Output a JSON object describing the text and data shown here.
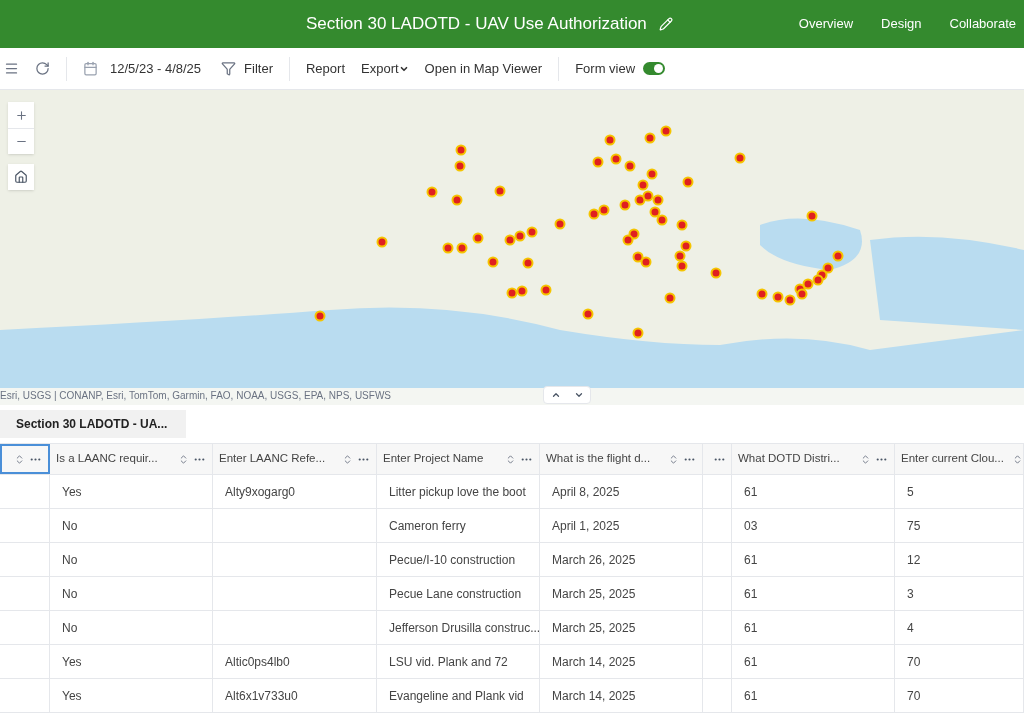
{
  "header": {
    "title": "Section 30 LADOTD - UAV Use Authorization",
    "nav": [
      "Overview",
      "Design",
      "Collaborate"
    ]
  },
  "toolbar": {
    "date_range": "12/5/23 - 4/8/25",
    "filter": "Filter",
    "actions": [
      "Report",
      "Export",
      "Open in Map Viewer"
    ],
    "form_view": {
      "label": "Form view",
      "on": true
    }
  },
  "map": {
    "attribution": "Esri, USGS | CONANP, Esri, TomTom, Garmin, FAO, NOAA, USGS, EPA, NPS, USFWS"
  },
  "table": {
    "tab": "Section 30 LADOTD - UA...",
    "columns": [
      {
        "sortable": true,
        "selected": true
      },
      {
        "label": "Is a LAANC requir...",
        "sortable": true,
        "selected": false
      },
      {
        "label": "Enter LAANC Refe...",
        "sortable": true,
        "selected": false
      },
      {
        "label": "Enter Project Name",
        "sortable": true,
        "selected": false
      },
      {
        "label": "What is the flight d...",
        "sortable": true,
        "selected": false
      },
      {
        "sortable": false,
        "selected": false
      },
      {
        "label": "What DOTD Distri...",
        "sortable": true,
        "selected": false
      },
      {
        "label": "Enter current Clou...",
        "sortable": true,
        "selected": false
      }
    ],
    "rows": [
      [
        null,
        "Yes",
        "Alty9xogarg0",
        "Litter pickup love the boot",
        "April 8, 2025",
        null,
        "61",
        "5"
      ],
      [
        null,
        "No",
        null,
        "Cameron ferry",
        "April 1, 2025",
        null,
        "03",
        "75"
      ],
      [
        null,
        "No",
        null,
        "Pecue/I-10 construction",
        "March 26, 2025",
        null,
        "61",
        "12"
      ],
      [
        null,
        "No",
        null,
        "Pecue Lane construction",
        "March 25, 2025",
        null,
        "61",
        "3"
      ],
      [
        null,
        "No",
        null,
        "Jefferson Drusilla construc...",
        "March 25, 2025",
        null,
        "61",
        "4"
      ],
      [
        null,
        "Yes",
        "Altic0ps4lb0",
        "LSU vid. Plank and 72",
        "March 14, 2025",
        null,
        "61",
        "70"
      ],
      [
        null,
        "Yes",
        "Alt6x1v733u0",
        "Evangeline and Plank vid",
        "March 14, 2025",
        null,
        "61",
        "70"
      ]
    ]
  }
}
